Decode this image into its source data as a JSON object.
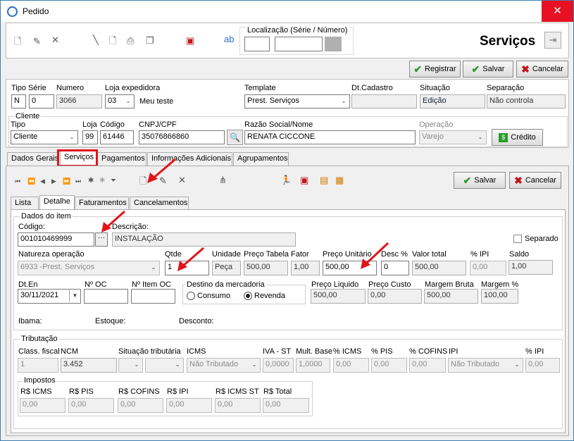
{
  "window": {
    "title": "Pedido",
    "close": "✕"
  },
  "toolbar": {
    "localizacao_label": "Localização (Série / Número)",
    "heading": "Serviços",
    "registrar": "Registrar",
    "salvar": "Salvar",
    "cancelar": "Cancelar"
  },
  "header": {
    "tipo_serie_label": "Tipo Série",
    "tipo": "N",
    "serie": "0",
    "numero_label": "Numero",
    "numero": "3066",
    "loja_exp_label": "Loja expedidora",
    "loja_exp": "03",
    "loja_exp_name": "Meu teste",
    "template_label": "Template",
    "template": "Prest. Serviços",
    "dtcadastro_label": "Dt.Cadastro",
    "dtcadastro": "",
    "situacao_label": "Situação",
    "situacao": "Edição",
    "separacao_label": "Separação",
    "separacao": "Não controla"
  },
  "cliente": {
    "group_label": "Cliente",
    "tipo_label": "Tipo",
    "tipo": "Cliente",
    "loja_label": "Loja",
    "loja": "99",
    "codigo_label": "Código",
    "codigo": "61446",
    "cnpj_label": "CNPJ/CPF",
    "cnpj": "35076866860",
    "razao_label": "Razão Social/Nome",
    "razao": "RENATA CICCONE",
    "operacao_label": "Operação",
    "operacao": "Varejo",
    "credito": "Crédito"
  },
  "tabs": [
    "Dados Gerais",
    "Serviços",
    "Pagamentos",
    "Informações Adicionais",
    "Agrupamentos"
  ],
  "subtabs": [
    "Lista",
    "Detalhe",
    "Faturamentos",
    "Cancelamentos"
  ],
  "item_toolbar": {
    "salvar": "Salvar",
    "cancelar": "Cancelar"
  },
  "item": {
    "group_label": "Dados do item",
    "codigo_label": "Código:",
    "codigo": "001010469999",
    "descricao_label": "Descrição:",
    "descricao": "INSTALAÇÃO",
    "separado_label": "Separado",
    "natureza_label": "Natureza operação",
    "natureza": "6933 -Prest. Serviços",
    "qtde_label": "Qtde",
    "qtde": "1",
    "unidade_label": "Unidade",
    "unidade": "Peça",
    "preco_tabela_label": "Preço Tabela",
    "preco_tabela": "500,00",
    "fator_label": "Fator",
    "fator": "1,00",
    "preco_unit_label": "Preço Unitário",
    "preco_unit": "500,00",
    "desc_label": "Desc %",
    "desc": "0",
    "valor_total_label": "Valor total",
    "valor_total": "500,00",
    "ipi_label": "% IPI",
    "ipi": "0,00",
    "saldo_label": "Saldo",
    "saldo": "1,00",
    "dten_label": "Dt.En",
    "dten": "30/11/2021",
    "noc_label": "Nº OC",
    "noc": "",
    "nitem_label": "Nº Item OC",
    "nitem": "",
    "destino_label": "Destino da mercadoria",
    "consumo": "Consumo",
    "revenda": "Revenda",
    "preco_liq_label": "Preço Liquido",
    "preco_liq": "500,00",
    "preco_custo_label": "Preço Custo",
    "preco_custo": "0,00",
    "margem_bruta_label": "Margem Bruta",
    "margem_bruta": "500,00",
    "margem_pct_label": "Margem %",
    "margem_pct": "100,00",
    "ibama_label": "Ibama:",
    "estoque_label": "Estoque:",
    "desconto_label": "Desconto:"
  },
  "tributacao": {
    "group_label": "Tributação",
    "class_fiscal_label": "Class. fiscal",
    "class_fiscal": "1",
    "ncm_label": "NCM",
    "ncm": "3.452",
    "sit_trib_label": "Situação tributária",
    "icms_label": "ICMS",
    "icms": "Não Tributado",
    "iva_label": "IVA - ST",
    "iva": "0,0000",
    "mult_label": "Mult. Base",
    "mult": "1,0000",
    "pct_icms_label": "% ICMS",
    "pct_icms": "0,00",
    "pct_pis_label": "% PIS",
    "pct_pis": "0,00",
    "pct_cofins_label": "% COFINS",
    "pct_cofins": "0,00",
    "ipi_label": "IPI",
    "ipi": "Não Tributado",
    "pct_ipi_label": "% IPI",
    "pct_ipi": "0,00"
  },
  "impostos": {
    "group_label": "Impostos",
    "icms_label": "R$ ICMS",
    "icms": "0,00",
    "pis_label": "R$ PIS",
    "pis": "0,00",
    "cofins_label": "R$ COFINS",
    "cofins": "0,00",
    "ipi_label": "R$ IPI",
    "ipi": "0,00",
    "icms_st_label": "R$ ICMS ST",
    "icms_st": "0,00",
    "total_label": "R$ Total",
    "total": "0,00"
  }
}
